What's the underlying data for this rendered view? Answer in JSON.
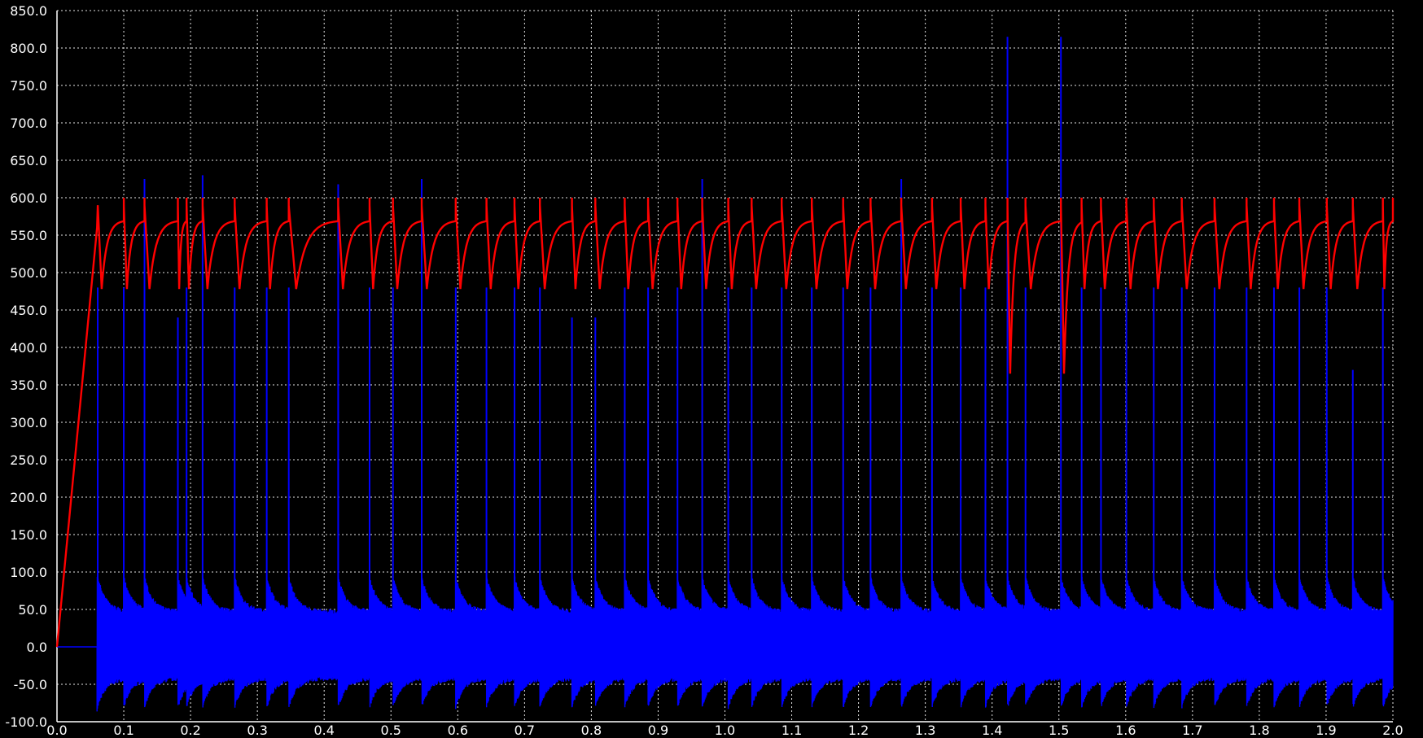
{
  "chart_data": {
    "type": "line",
    "xlim": [
      0.0,
      2.0
    ],
    "ylim": [
      -100.0,
      850.0
    ],
    "x_ticks": [
      "0.0",
      "0.1",
      "0.2",
      "0.3",
      "0.4",
      "0.5",
      "0.6",
      "0.7",
      "0.8",
      "0.9",
      "1.0",
      "1.1",
      "1.2",
      "1.3",
      "1.4",
      "1.5",
      "1.6",
      "1.7",
      "1.8",
      "1.9",
      "2.0"
    ],
    "y_ticks": [
      "850.0",
      "800.0",
      "750.0",
      "700.0",
      "650.0",
      "600.0",
      "550.0",
      "500.0",
      "450.0",
      "400.0",
      "350.0",
      "300.0",
      "250.0",
      "200.0",
      "150.0",
      "100.0",
      "50.0",
      "0.0",
      "-50.0",
      "-100.0"
    ],
    "grid": true,
    "background": "#000000",
    "series": [
      {
        "color": "#ff0000",
        "style": "voltage-like sawtooth",
        "start_ramp": {
          "x": [
            0.0,
            0.06
          ],
          "y": [
            0,
            560
          ]
        },
        "band": [
          475,
          580
        ],
        "peak": 600,
        "dips": [
          {
            "x": 1.423,
            "y": 365
          },
          {
            "x": 1.503,
            "y": 365
          }
        ]
      },
      {
        "color": "#0000ff",
        "style": "current-like oscillation with spikes",
        "zero_until": 0.06,
        "band": [
          -80,
          60
        ],
        "spike_x": [
          0.061,
          0.1,
          0.131,
          0.181,
          0.194,
          0.218,
          0.266,
          0.314,
          0.347,
          0.421,
          0.468,
          0.503,
          0.546,
          0.597,
          0.643,
          0.685,
          0.723,
          0.771,
          0.806,
          0.85,
          0.885,
          0.929,
          0.966,
          1.005,
          1.04,
          1.085,
          1.13,
          1.177,
          1.218,
          1.264,
          1.31,
          1.353,
          1.39,
          1.423,
          1.45,
          1.503,
          1.534,
          1.563,
          1.601,
          1.642,
          1.684,
          1.733,
          1.781,
          1.822,
          1.86,
          1.901,
          1.94,
          1.985
        ],
        "spike_y": [
          480,
          480,
          625,
          440,
          480,
          630,
          480,
          480,
          480,
          618,
          480,
          480,
          625,
          480,
          480,
          480,
          480,
          440,
          440,
          480,
          480,
          480,
          625,
          480,
          480,
          480,
          480,
          480,
          480,
          625,
          480,
          480,
          480,
          815,
          480,
          815,
          480,
          480,
          480,
          480,
          480,
          480,
          480,
          480,
          480,
          480,
          370,
          480
        ]
      }
    ]
  }
}
